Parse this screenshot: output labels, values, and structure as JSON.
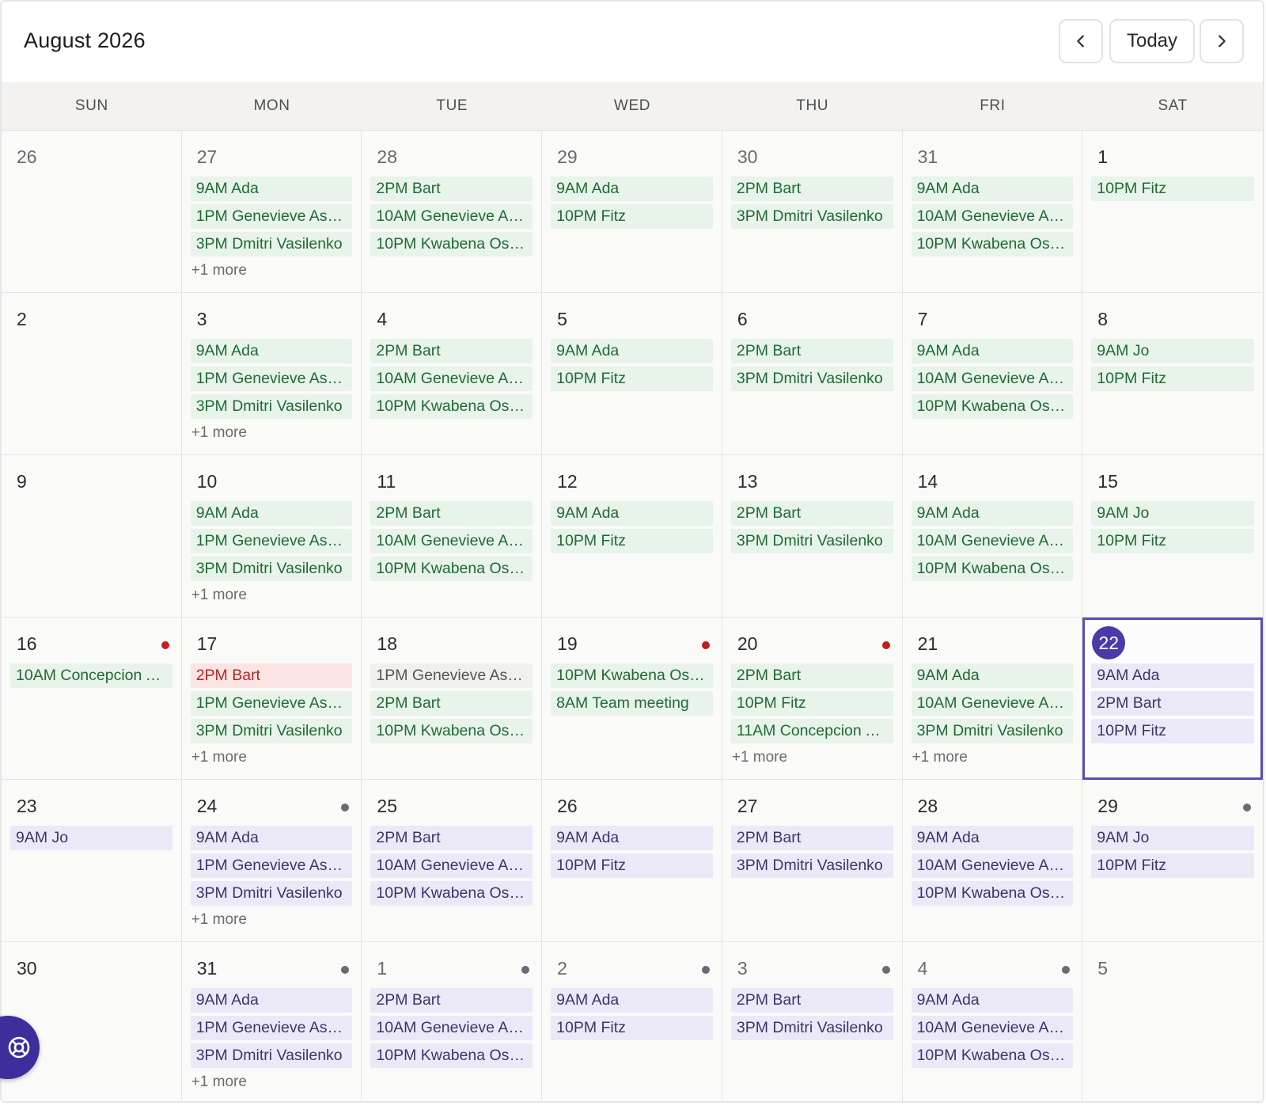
{
  "header": {
    "title": "August 2026",
    "today_label": "Today",
    "prev_icon": "chevron-left-icon",
    "next_icon": "chevron-right-icon"
  },
  "weekdays": [
    "SUN",
    "MON",
    "TUE",
    "WED",
    "THU",
    "FRI",
    "SAT"
  ],
  "colors": {
    "past_event_bg": "#e8f3ea",
    "past_event_text": "#1f6a37",
    "future_event_bg": "#ebe9f7",
    "future_event_text": "#3a3668",
    "conflict_event_bg": "#fbe4e4",
    "conflict_event_text": "#b52525",
    "today_accent": "#4a3aa8",
    "dot_red": "#c21d1d",
    "dot_gray": "#6a6a72"
  },
  "weeks": [
    [
      {
        "day": "26",
        "other": true,
        "events": []
      },
      {
        "day": "27",
        "other": true,
        "events": [
          {
            "label": "9AM Ada",
            "style": "past"
          },
          {
            "label": "1PM Genevieve Ash...",
            "style": "past"
          },
          {
            "label": "3PM Dmitri Vasilenko",
            "style": "past"
          }
        ],
        "more": "+1 more"
      },
      {
        "day": "28",
        "other": true,
        "events": [
          {
            "label": "2PM Bart",
            "style": "past"
          },
          {
            "label": "10AM Genevieve As...",
            "style": "past"
          },
          {
            "label": "10PM Kwabena Ose...",
            "style": "past"
          }
        ]
      },
      {
        "day": "29",
        "other": true,
        "events": [
          {
            "label": "9AM Ada",
            "style": "past"
          },
          {
            "label": "10PM Fitz",
            "style": "past"
          }
        ]
      },
      {
        "day": "30",
        "other": true,
        "events": [
          {
            "label": "2PM Bart",
            "style": "past"
          },
          {
            "label": "3PM Dmitri Vasilenko",
            "style": "past"
          }
        ]
      },
      {
        "day": "31",
        "other": true,
        "events": [
          {
            "label": "9AM Ada",
            "style": "past"
          },
          {
            "label": "10AM Genevieve As...",
            "style": "past"
          },
          {
            "label": "10PM Kwabena Ose...",
            "style": "past"
          }
        ]
      },
      {
        "day": "1",
        "events": [
          {
            "label": "10PM Fitz",
            "style": "past"
          }
        ]
      }
    ],
    [
      {
        "day": "2",
        "events": []
      },
      {
        "day": "3",
        "events": [
          {
            "label": "9AM Ada",
            "style": "past"
          },
          {
            "label": "1PM Genevieve Ash...",
            "style": "past"
          },
          {
            "label": "3PM Dmitri Vasilenko",
            "style": "past"
          }
        ],
        "more": "+1 more"
      },
      {
        "day": "4",
        "events": [
          {
            "label": "2PM Bart",
            "style": "past"
          },
          {
            "label": "10AM Genevieve As...",
            "style": "past"
          },
          {
            "label": "10PM Kwabena Ose...",
            "style": "past"
          }
        ]
      },
      {
        "day": "5",
        "events": [
          {
            "label": "9AM Ada",
            "style": "past"
          },
          {
            "label": "10PM Fitz",
            "style": "past"
          }
        ]
      },
      {
        "day": "6",
        "events": [
          {
            "label": "2PM Bart",
            "style": "past"
          },
          {
            "label": "3PM Dmitri Vasilenko",
            "style": "past"
          }
        ]
      },
      {
        "day": "7",
        "events": [
          {
            "label": "9AM Ada",
            "style": "past"
          },
          {
            "label": "10AM Genevieve As...",
            "style": "past"
          },
          {
            "label": "10PM Kwabena Ose...",
            "style": "past"
          }
        ]
      },
      {
        "day": "8",
        "events": [
          {
            "label": "9AM Jo",
            "style": "past"
          },
          {
            "label": "10PM Fitz",
            "style": "past"
          }
        ]
      }
    ],
    [
      {
        "day": "9",
        "events": []
      },
      {
        "day": "10",
        "events": [
          {
            "label": "9AM Ada",
            "style": "past"
          },
          {
            "label": "1PM Genevieve Ash...",
            "style": "past"
          },
          {
            "label": "3PM Dmitri Vasilenko",
            "style": "past"
          }
        ],
        "more": "+1 more"
      },
      {
        "day": "11",
        "events": [
          {
            "label": "2PM Bart",
            "style": "past"
          },
          {
            "label": "10AM Genevieve As...",
            "style": "past"
          },
          {
            "label": "10PM Kwabena Ose...",
            "style": "past"
          }
        ]
      },
      {
        "day": "12",
        "events": [
          {
            "label": "9AM Ada",
            "style": "past"
          },
          {
            "label": "10PM Fitz",
            "style": "past"
          }
        ]
      },
      {
        "day": "13",
        "events": [
          {
            "label": "2PM Bart",
            "style": "past"
          },
          {
            "label": "3PM Dmitri Vasilenko",
            "style": "past"
          }
        ]
      },
      {
        "day": "14",
        "events": [
          {
            "label": "9AM Ada",
            "style": "past"
          },
          {
            "label": "10AM Genevieve As...",
            "style": "past"
          },
          {
            "label": "10PM Kwabena Ose...",
            "style": "past"
          }
        ]
      },
      {
        "day": "15",
        "events": [
          {
            "label": "9AM Jo",
            "style": "past"
          },
          {
            "label": "10PM Fitz",
            "style": "past"
          }
        ]
      }
    ],
    [
      {
        "day": "16",
        "dot": "red",
        "events": [
          {
            "label": "10AM Concepcion A...",
            "style": "past"
          }
        ]
      },
      {
        "day": "17",
        "events": [
          {
            "label": "2PM Bart",
            "style": "danger"
          },
          {
            "label": "1PM Genevieve Ash...",
            "style": "past"
          },
          {
            "label": "3PM Dmitri Vasilenko",
            "style": "past"
          }
        ],
        "more": "+1 more"
      },
      {
        "day": "18",
        "events": [
          {
            "label": "1PM Genevieve Ash...",
            "style": "gray-text"
          },
          {
            "label": "2PM Bart",
            "style": "past"
          },
          {
            "label": "10PM Kwabena Ose...",
            "style": "past"
          }
        ]
      },
      {
        "day": "19",
        "dot": "red",
        "events": [
          {
            "label": "10PM Kwabena Ose...",
            "style": "past"
          },
          {
            "label": "8AM Team meeting",
            "style": "past"
          }
        ]
      },
      {
        "day": "20",
        "dot": "red",
        "events": [
          {
            "label": "2PM Bart",
            "style": "past"
          },
          {
            "label": "10PM Fitz",
            "style": "past"
          },
          {
            "label": "11AM Concepcion A...",
            "style": "past"
          }
        ],
        "more": "+1 more"
      },
      {
        "day": "21",
        "events": [
          {
            "label": "9AM Ada",
            "style": "past"
          },
          {
            "label": "10AM Genevieve As...",
            "style": "past"
          },
          {
            "label": "3PM Dmitri Vasilenko",
            "style": "past"
          }
        ],
        "more": "+1 more"
      },
      {
        "day": "22",
        "today": true,
        "events": [
          {
            "label": "9AM Ada",
            "style": "future"
          },
          {
            "label": "2PM Bart",
            "style": "future"
          },
          {
            "label": "10PM Fitz",
            "style": "future"
          }
        ]
      }
    ],
    [
      {
        "day": "23",
        "events": [
          {
            "label": "9AM Jo",
            "style": "future"
          }
        ]
      },
      {
        "day": "24",
        "dot": "gray",
        "events": [
          {
            "label": "9AM Ada",
            "style": "future"
          },
          {
            "label": "1PM Genevieve Ash...",
            "style": "future"
          },
          {
            "label": "3PM Dmitri Vasilenko",
            "style": "future"
          }
        ],
        "more": "+1 more"
      },
      {
        "day": "25",
        "events": [
          {
            "label": "2PM Bart",
            "style": "future"
          },
          {
            "label": "10AM Genevieve As...",
            "style": "future"
          },
          {
            "label": "10PM Kwabena Ose...",
            "style": "future"
          }
        ]
      },
      {
        "day": "26",
        "events": [
          {
            "label": "9AM Ada",
            "style": "future"
          },
          {
            "label": "10PM Fitz",
            "style": "future"
          }
        ]
      },
      {
        "day": "27",
        "events": [
          {
            "label": "2PM Bart",
            "style": "future"
          },
          {
            "label": "3PM Dmitri Vasilenko",
            "style": "future"
          }
        ]
      },
      {
        "day": "28",
        "events": [
          {
            "label": "9AM Ada",
            "style": "future"
          },
          {
            "label": "10AM Genevieve As...",
            "style": "future"
          },
          {
            "label": "10PM Kwabena Ose...",
            "style": "future"
          }
        ]
      },
      {
        "day": "29",
        "dot": "gray",
        "events": [
          {
            "label": "9AM Jo",
            "style": "future"
          },
          {
            "label": "10PM Fitz",
            "style": "future"
          }
        ]
      }
    ],
    [
      {
        "day": "30",
        "events": []
      },
      {
        "day": "31",
        "dot": "gray",
        "events": [
          {
            "label": "9AM Ada",
            "style": "future"
          },
          {
            "label": "1PM Genevieve Ash...",
            "style": "future"
          },
          {
            "label": "3PM Dmitri Vasilenko",
            "style": "future"
          }
        ],
        "more": "+1 more"
      },
      {
        "day": "1",
        "other": true,
        "dot": "gray",
        "events": [
          {
            "label": "2PM Bart",
            "style": "future"
          },
          {
            "label": "10AM Genevieve As...",
            "style": "future"
          },
          {
            "label": "10PM Kwabena Ose...",
            "style": "future"
          }
        ]
      },
      {
        "day": "2",
        "other": true,
        "dot": "gray",
        "events": [
          {
            "label": "9AM Ada",
            "style": "future"
          },
          {
            "label": "10PM Fitz",
            "style": "future"
          }
        ]
      },
      {
        "day": "3",
        "other": true,
        "dot": "gray",
        "events": [
          {
            "label": "2PM Bart",
            "style": "future"
          },
          {
            "label": "3PM Dmitri Vasilenko",
            "style": "future"
          }
        ]
      },
      {
        "day": "4",
        "other": true,
        "dot": "gray",
        "events": [
          {
            "label": "9AM Ada",
            "style": "future"
          },
          {
            "label": "10AM Genevieve As...",
            "style": "future"
          },
          {
            "label": "10PM Kwabena Ose...",
            "style": "future"
          }
        ]
      },
      {
        "day": "5",
        "other": true,
        "events": []
      }
    ]
  ],
  "help_button_icon": "lifebuoy-icon"
}
